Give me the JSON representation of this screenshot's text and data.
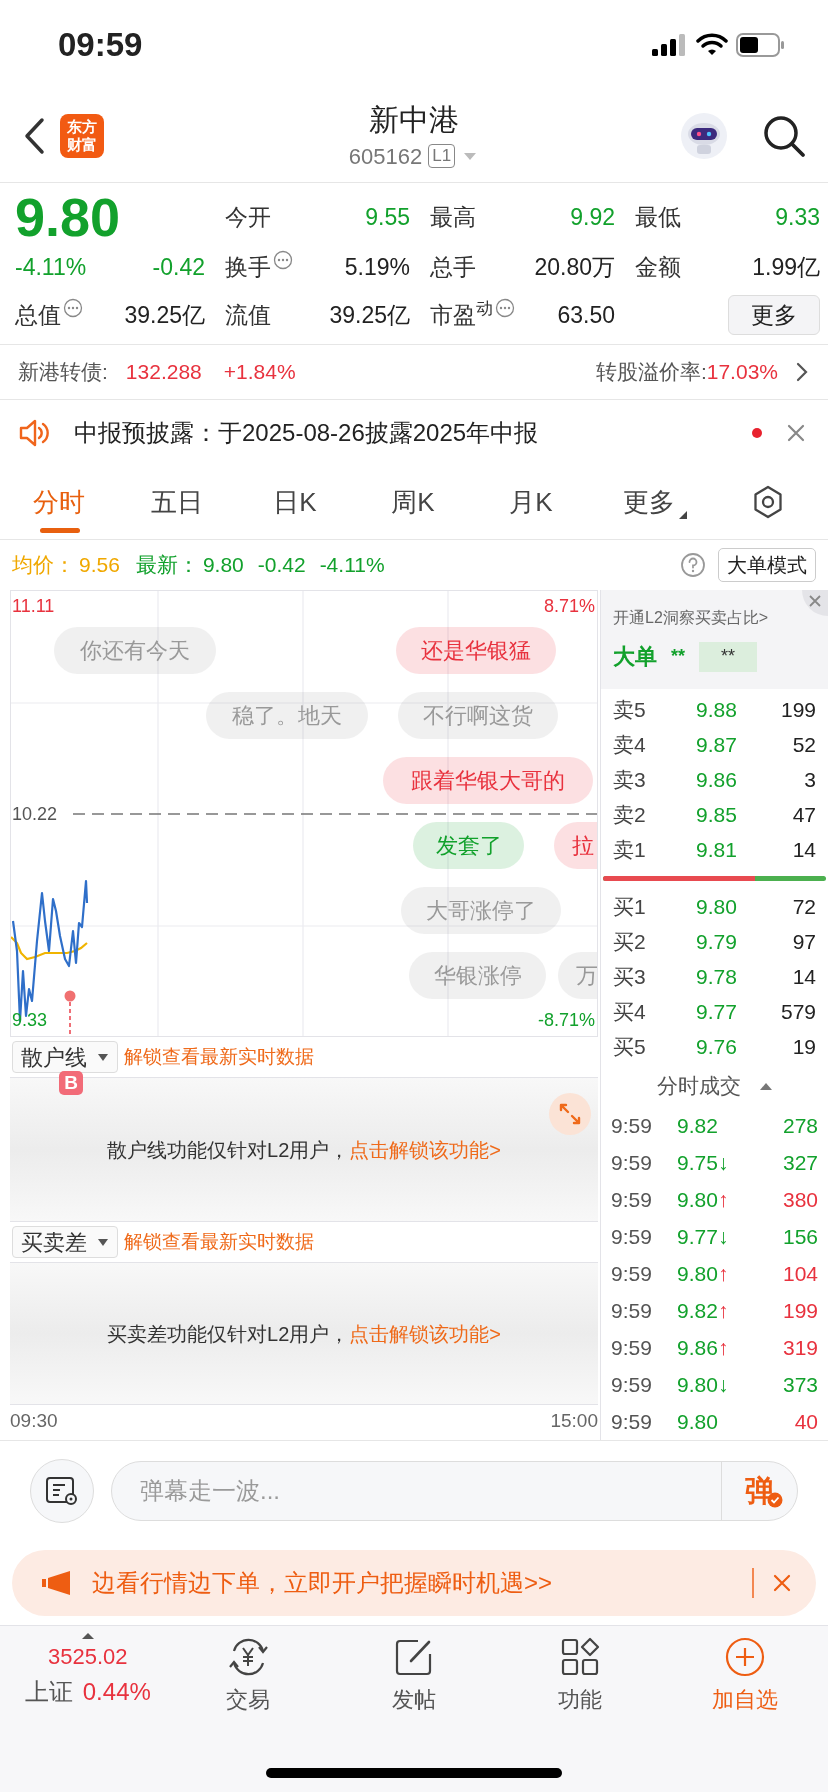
{
  "status_bar": {
    "time": "09:59"
  },
  "header": {
    "logo_lines": [
      "东方",
      "财富"
    ],
    "title": "新中港",
    "code": "605162",
    "level_badge": "L1"
  },
  "quote": {
    "price": "9.80",
    "change_pct": "-4.11%",
    "change": "-0.42",
    "total_value": {
      "label": "总值",
      "value": "39.25亿",
      "info": true
    },
    "stats": [
      {
        "label": "今开",
        "value": "9.55",
        "color": "#12a12c",
        "info": false
      },
      {
        "label": "最高",
        "value": "9.92",
        "color": "#12a12c",
        "info": false
      },
      {
        "label": "最低",
        "value": "9.33",
        "color": "#12a12c",
        "info": false
      },
      {
        "label": "换手",
        "value": "5.19%",
        "color": "#222222",
        "info": true
      },
      {
        "label": "总手",
        "value": "20.80万",
        "color": "#222222",
        "info": false
      },
      {
        "label": "金额",
        "value": "1.99亿",
        "color": "#222222",
        "info": false
      },
      {
        "label": "流值",
        "value": "39.25亿",
        "color": "#222222",
        "info": false
      },
      {
        "label": "市盈$^{动}$",
        "value": "63.50",
        "color": "#222222",
        "info": true
      }
    ],
    "more_button": "更多"
  },
  "bond": {
    "label": "新港转债:",
    "price": "132.288",
    "change": "+1.84%",
    "premium_label": "转股溢价率:",
    "premium": "17.03%"
  },
  "notice": {
    "text": "中报预披露：于2025-08-26披露2025年中报",
    "unread": true
  },
  "tabs": [
    {
      "label": "分时",
      "selected": true,
      "kind": "tab"
    },
    {
      "label": "五日",
      "selected": false,
      "kind": "tab"
    },
    {
      "label": "日K",
      "selected": false,
      "kind": "tab"
    },
    {
      "label": "周K",
      "selected": false,
      "kind": "tab"
    },
    {
      "label": "月K",
      "selected": false,
      "kind": "tab"
    },
    {
      "label": "更多",
      "selected": false,
      "kind": "menu"
    }
  ],
  "summary": {
    "avg_label": "均价：",
    "avg": "9.56",
    "latest_label": "最新：",
    "latest": "9.80",
    "change": "-0.42",
    "change_pct": "-4.11%",
    "mode_button": "大单模式"
  },
  "chart": {
    "top_price": "11.11",
    "top_pct": "8.71%",
    "mid_price": "10.22",
    "bottom_price": "9.33",
    "bottom_pct": "-8.71%",
    "trade_marker": "B"
  },
  "danmaku": [
    {
      "text": "你还有今天",
      "color": "#999999"
    },
    {
      "text": "还是华银猛",
      "color": "#e8323e"
    },
    {
      "text": "稳了。地天",
      "color": "#999999"
    },
    {
      "text": "不行啊这货",
      "color": "#999999"
    },
    {
      "text": "跟着华银大哥的",
      "color": "#e8323e"
    },
    {
      "text": "发套了",
      "color": "#12a12c"
    },
    {
      "text": "拉",
      "color": "#e8323e"
    },
    {
      "text": "大哥涨停了",
      "color": "#999999"
    },
    {
      "text": "华银涨停",
      "color": "#999999"
    },
    {
      "text": "万",
      "color": "#999999"
    }
  ],
  "indicators": [
    {
      "name": "散户线",
      "unlock": "解锁查看最新实时数据",
      "message": "散户线功能仅针对L2用户，",
      "link": "点击解锁该功能>",
      "expandable": true
    },
    {
      "name": "买卖差",
      "unlock": "解锁查看最新实时数据",
      "message": "买卖差功能仅针对L2用户，",
      "link": "点击解锁该功能>",
      "expandable": false
    }
  ],
  "time_axis": [
    "09:30",
    "15:00"
  ],
  "order_book": {
    "promo": "开通L2洞察买卖占比>",
    "big_order_label": "大单",
    "big_order_value": "**",
    "big_order_box": "**",
    "asks": [
      {
        "label": "卖5",
        "price": "9.88",
        "volume": "199"
      },
      {
        "label": "卖4",
        "price": "9.87",
        "volume": "52"
      },
      {
        "label": "卖3",
        "price": "9.86",
        "volume": "3"
      },
      {
        "label": "卖2",
        "price": "9.85",
        "volume": "47"
      },
      {
        "label": "卖1",
        "price": "9.81",
        "volume": "14"
      }
    ],
    "bid_ask_bar": {
      "level": 0.68
    },
    "bids": [
      {
        "label": "买1",
        "price": "9.80",
        "volume": "72"
      },
      {
        "label": "买2",
        "price": "9.79",
        "volume": "97"
      },
      {
        "label": "买3",
        "price": "9.78",
        "volume": "14"
      },
      {
        "label": "买4",
        "price": "9.77",
        "volume": "579"
      },
      {
        "label": "买5",
        "price": "9.76",
        "volume": "19"
      }
    ],
    "trades_title": "分时成交",
    "trades": [
      {
        "time": "9:59",
        "price": "9.82",
        "color": "#12a12c",
        "volume": "278"
      },
      {
        "time": "9:59",
        "price": "9.75",
        "arrow": "↓",
        "color": "#12a12c",
        "volume": "327"
      },
      {
        "time": "9:59",
        "price": "9.80",
        "arrow": "↑",
        "color": "#e8323e",
        "volume": "380"
      },
      {
        "time": "9:59",
        "price": "9.77",
        "arrow": "↓",
        "color": "#12a12c",
        "volume": "156"
      },
      {
        "time": "9:59",
        "price": "9.80",
        "arrow": "↑",
        "color": "#e8323e",
        "volume": "104"
      },
      {
        "time": "9:59",
        "price": "9.82",
        "arrow": "↑",
        "color": "#e8323e",
        "volume": "199"
      },
      {
        "time": "9:59",
        "price": "9.86",
        "arrow": "↑",
        "color": "#e8323e",
        "volume": "319"
      },
      {
        "time": "9:59",
        "price": "9.80",
        "arrow": "↓",
        "color": "#12a12c",
        "volume": "373"
      },
      {
        "time": "9:59",
        "price": "9.80",
        "color": "#e8323e",
        "volume": "40"
      }
    ]
  },
  "comment": {
    "placeholder": "弹幕走一波...",
    "send_label": "弹"
  },
  "ad": {
    "text": "边看行情边下单，立即开户把握瞬时机遇>>"
  },
  "bottom_nav": [
    {
      "kind": "index",
      "value": "3525.02",
      "label": "上证",
      "change": "0.44%"
    },
    {
      "kind": "trade",
      "label": "交易",
      "accent": false
    },
    {
      "kind": "post",
      "label": "发帖",
      "accent": false
    },
    {
      "kind": "functions",
      "label": "功能",
      "accent": false
    },
    {
      "kind": "add",
      "label": "加自选",
      "accent": true
    }
  ]
}
